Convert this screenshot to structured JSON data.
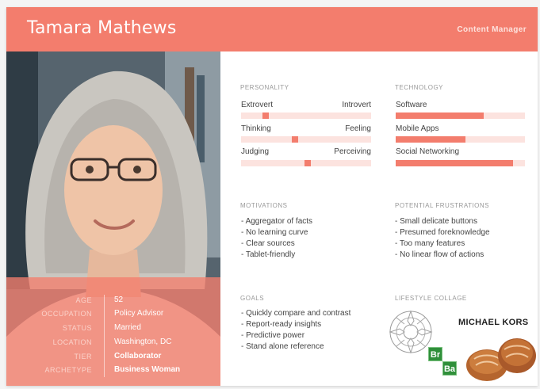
{
  "header": {
    "name": "Tamara Mathews",
    "role": "Content Manager"
  },
  "profile": {
    "rows": [
      {
        "label": "AGE",
        "value": "52",
        "bold": false
      },
      {
        "label": "OCCUPATION",
        "value": "Policy Advisor",
        "bold": false
      },
      {
        "label": "STATUS",
        "value": "Married",
        "bold": false
      },
      {
        "label": "LOCATION",
        "value": "Washington, DC",
        "bold": false
      },
      {
        "label": "TIER",
        "value": "Collaborator",
        "bold": true
      },
      {
        "label": "ARCHETYPE",
        "value": "Business Woman",
        "bold": true
      }
    ]
  },
  "personality": {
    "title": "PERSONALITY",
    "scales": [
      {
        "left": "Extrovert",
        "right": "Introvert",
        "position": 0.17
      },
      {
        "left": "Thinking",
        "right": "Feeling",
        "position": 0.41
      },
      {
        "left": "Judging",
        "right": "Perceiving",
        "position": 0.51
      }
    ]
  },
  "technology": {
    "title": "TECHNOLOGY",
    "items": [
      {
        "label": "Software",
        "level": 0.68
      },
      {
        "label": "Mobile Apps",
        "level": 0.54
      },
      {
        "label": "Social Networking",
        "level": 0.91
      }
    ]
  },
  "motivations": {
    "title": "MOTIVATIONS",
    "items": [
      "Aggregator of facts",
      "No learning curve",
      "Clear sources",
      "Tablet-friendly"
    ]
  },
  "frustrations": {
    "title": "POTENTIAL FRUSTRATIONS",
    "items": [
      "Small delicate buttons",
      "Presumed foreknowledge",
      "Too many features",
      "No linear flow of actions"
    ]
  },
  "goals": {
    "title": "GOALS",
    "items": [
      "Quickly compare and contrast",
      "Report-ready insights",
      "Predictive power",
      "Stand alone reference"
    ]
  },
  "lifestyle": {
    "title": "LIFESTYLE COLLAGE",
    "brand": "MICHAEL KORS",
    "element1": "Br",
    "element2": "Ba"
  }
}
